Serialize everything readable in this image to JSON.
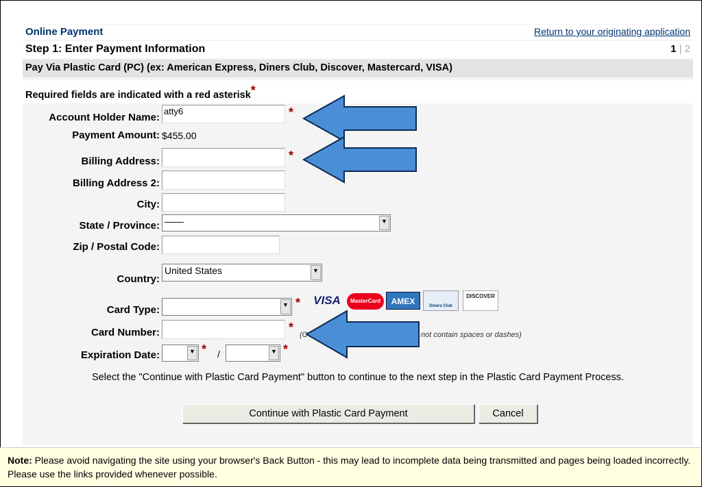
{
  "header": {
    "title": "Online Payment",
    "return_link": "Return to your originating application",
    "step_title": "Step 1: Enter Payment Information",
    "step_current": "1",
    "step_sep": "|",
    "step_next": "2"
  },
  "pay_via": "Pay Via Plastic Card (PC) (ex: American Express, Diners Club, Discover, Mastercard, VISA)",
  "required_note": "Required fields are indicated with a red asterisk",
  "asterisk": "*",
  "form": {
    "account_holder_label": "Account Holder Name:",
    "account_holder_value": "atty6",
    "payment_amount_label": "Payment Amount:",
    "payment_amount_value": "$455.00",
    "billing_address_label": "Billing Address:",
    "billing_address2_label": "Billing Address 2:",
    "city_label": "City:",
    "state_label": "State / Province:",
    "state_value": "——",
    "zip_label": "Zip / Postal Code:",
    "country_label": "Country:",
    "country_value": "United States",
    "card_type_label": "Card Type:",
    "card_number_label": "Card Number:",
    "card_number_hint_start": "(C",
    "card_number_hint_end": "not contain spaces or dashes)",
    "expiration_label": "Expiration Date:",
    "expiration_sep": "/"
  },
  "card_logos": [
    "VISA",
    "MasterCard",
    "AMEX",
    "Diners Club",
    "DISCOVER"
  ],
  "instruction": "Select the \"Continue with Plastic Card Payment\" button to continue to the next step in the Plastic Card Payment Process.",
  "buttons": {
    "continue": "Continue with Plastic Card Payment",
    "cancel": "Cancel"
  },
  "note": {
    "label": "Note:",
    "text": " Please avoid navigating the site using your browser's Back Button - this may lead to incomplete data being transmitted and pages being loaded incorrectly. Please use the links provided whenever possible."
  },
  "colors": {
    "title_blue": "#00336f",
    "asterisk_red": "#a00000",
    "annotation_arrow": "#4a8fd6"
  }
}
